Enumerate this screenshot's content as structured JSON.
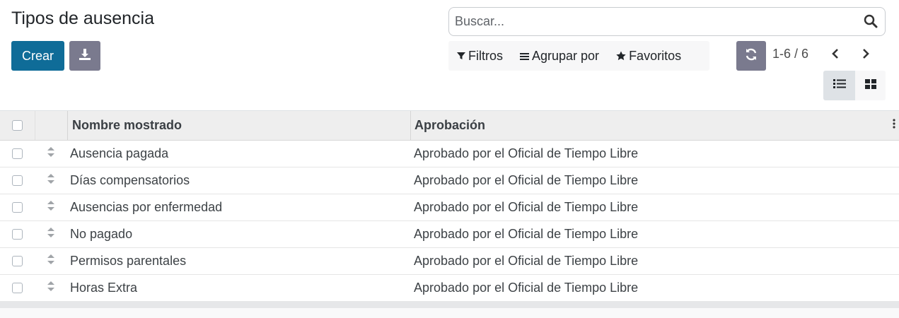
{
  "page": {
    "title": "Tipos de ausencia"
  },
  "toolbar": {
    "create_label": "Crear",
    "download_icon": "download-icon"
  },
  "search": {
    "placeholder": "Buscar...",
    "value": ""
  },
  "filters": {
    "filters_label": "Filtros",
    "group_by_label": "Agrupar por",
    "favorites_label": "Favoritos"
  },
  "pager": {
    "range": "1-6 / 6"
  },
  "table": {
    "columns": [
      "Nombre mostrado",
      "Aprobación"
    ],
    "rows": [
      {
        "name": "Ausencia pagada",
        "approval": "Aprobado por el Oficial de Tiempo Libre"
      },
      {
        "name": "Días compensatorios",
        "approval": "Aprobado por el Oficial de Tiempo Libre"
      },
      {
        "name": "Ausencias por enfermedad",
        "approval": "Aprobado por el Oficial de Tiempo Libre"
      },
      {
        "name": "No pagado",
        "approval": "Aprobado por el Oficial de Tiempo Libre"
      },
      {
        "name": "Permisos parentales",
        "approval": "Aprobado por el Oficial de Tiempo Libre"
      },
      {
        "name": "Horas Extra",
        "approval": "Aprobado por el Oficial de Tiempo Libre"
      }
    ]
  },
  "colors": {
    "primary": "#0f6c98",
    "secondary": "#7a7a8e",
    "header_bg": "#eeeeee"
  }
}
